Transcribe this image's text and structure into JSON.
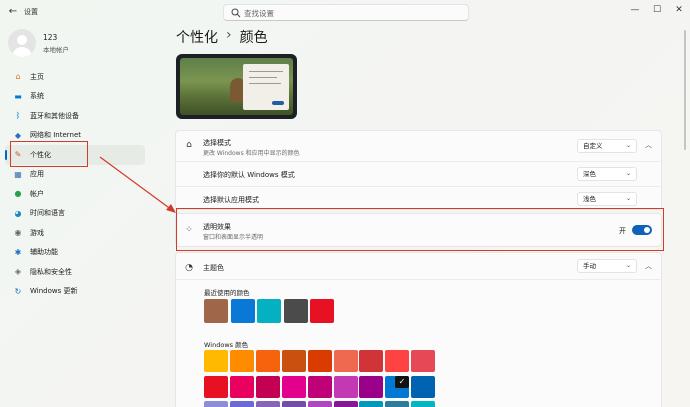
{
  "window": {
    "title": "设置",
    "back": "←",
    "min": "—",
    "max": "☐",
    "close": "✕"
  },
  "search": {
    "placeholder": "查找设置"
  },
  "user": {
    "name": "123",
    "sub": "本地帐户"
  },
  "sidebar": {
    "items": [
      {
        "label": "主页",
        "icon": "home-icon",
        "color": "#e06c2a",
        "glyph": "⌂"
      },
      {
        "label": "系统",
        "icon": "monitor-icon",
        "color": "#0078d4",
        "glyph": "▬"
      },
      {
        "label": "蓝牙和其他设备",
        "icon": "bluetooth-icon",
        "color": "#0078d4",
        "glyph": "ᛒ"
      },
      {
        "label": "网络和 Internet",
        "icon": "wifi-icon",
        "color": "#2b6fbf",
        "glyph": "◆"
      },
      {
        "label": "个性化",
        "icon": "brush-icon",
        "color": "#c65a2a",
        "glyph": "✎"
      },
      {
        "label": "应用",
        "icon": "apps-icon",
        "color": "#3a6ea8",
        "glyph": "▦"
      },
      {
        "label": "帐户",
        "icon": "account-icon",
        "color": "#27a04a",
        "glyph": "●"
      },
      {
        "label": "时间和语言",
        "icon": "globe-icon",
        "color": "#1d86c8",
        "glyph": "◕"
      },
      {
        "label": "游戏",
        "icon": "gamepad-icon",
        "color": "#666666",
        "glyph": "◉"
      },
      {
        "label": "辅助功能",
        "icon": "accessibility-icon",
        "color": "#1b6fc0",
        "glyph": "✱"
      },
      {
        "label": "隐私和安全性",
        "icon": "shield-icon",
        "color": "#666666",
        "glyph": "◈"
      },
      {
        "label": "Windows 更新",
        "icon": "update-icon",
        "color": "#1b6fc0",
        "glyph": "↻"
      }
    ]
  },
  "breadcrumb": {
    "parent": "个性化",
    "sep": "›",
    "current": "颜色"
  },
  "mode": {
    "title": "选择模式",
    "sub": "更改 Windows 和应用中显示的颜色",
    "value": "自定义",
    "windows_mode_label": "选择你的默认 Windows 模式",
    "windows_mode_value": "深色",
    "app_mode_label": "选择默认应用模式",
    "app_mode_value": "浅色"
  },
  "transparency": {
    "title": "透明效果",
    "sub": "窗口和表面显示半透明",
    "state": "开"
  },
  "accent": {
    "title": "主题色",
    "value": "手动",
    "recent_label": "最近使用的颜色",
    "recent": [
      "#a0664a",
      "#0a78d7",
      "#05b1c1",
      "#4b4b4b",
      "#e81123"
    ],
    "windows_label": "Windows 颜色",
    "row1": [
      "#ffb900",
      "#ff8c00",
      "#f7630c",
      "#ca5010",
      "#da3b01",
      "#ef6950",
      "#d13438",
      "#ff4343",
      "#e74856"
    ],
    "row2": [
      "#e81123",
      "#ea005e",
      "#c30052",
      "#e3008c",
      "#bf0077",
      "#c239b3",
      "#9a0089",
      "#0078d4",
      "#0063b1"
    ],
    "row3": [
      "#8e8cd8",
      "#6b69d6",
      "#8764b8",
      "#744da9",
      "#b146c2",
      "#881798",
      "#0099bc",
      "#2d7d9a",
      "#00b7c3"
    ],
    "selected_check": "✓"
  },
  "colors": {
    "accent": "#0067c0",
    "annotation": "#d23a2a"
  }
}
